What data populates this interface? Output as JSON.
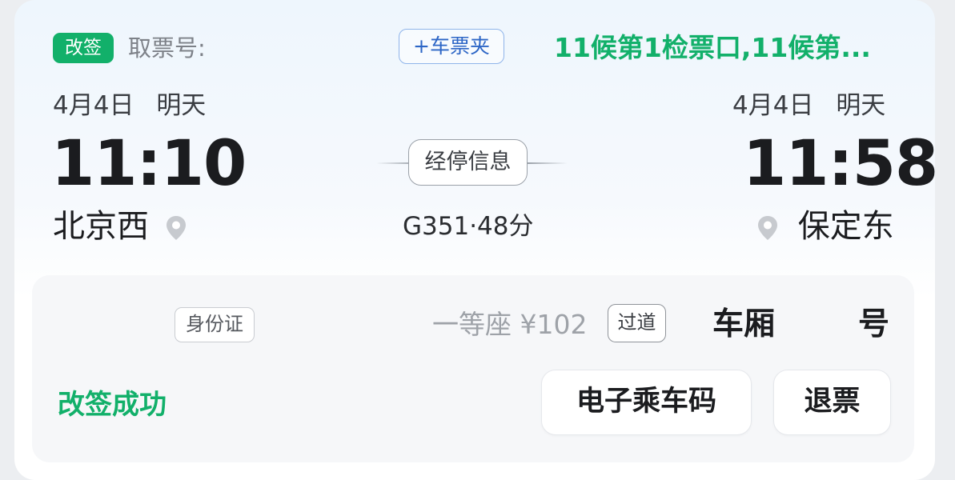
{
  "ticket": {
    "status_badge": "改签",
    "pickup_label": "取票号:",
    "add_wallet_label": "+车票夹",
    "gate_info": "11候第1检票口,11候第...",
    "depart": {
      "date": "4月4日",
      "day": "明天",
      "time": "11:10",
      "station": "北京西"
    },
    "arrive": {
      "date": "4月4日",
      "day": "明天",
      "time": "11:58",
      "station": "保定东"
    },
    "stops_label": "经停信息",
    "train_info": "G351·48分",
    "id_type": "身份证",
    "seat_class_price": "一等座 ¥102",
    "seat_position": "过道",
    "coach_label": "车厢",
    "seat_number_label": "号",
    "result_status": "改签成功",
    "buttons": {
      "e_code": "电子乘车码",
      "refund": "退票"
    }
  },
  "colors": {
    "accent_green": "#12b06a",
    "wallet_blue": "#2d66c6",
    "text_dark": "#1b1c1f",
    "text_muted": "#7d8188"
  },
  "icons": [
    "location-pin-icon"
  ]
}
